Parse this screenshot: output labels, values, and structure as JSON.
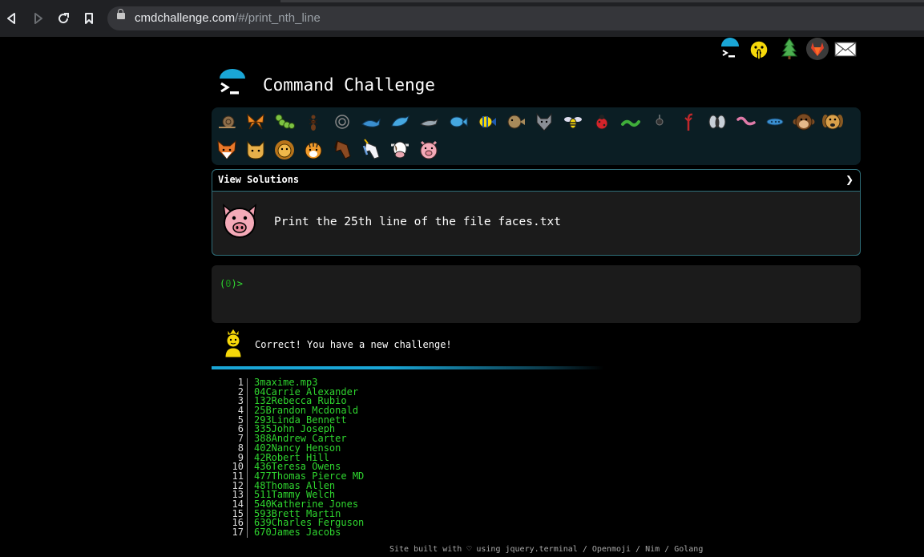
{
  "browser": {
    "url_host": "cmdchallenge.com",
    "url_path": "/#/print_nth_line"
  },
  "top_icons": [
    "terminal-icon",
    "shushing-face-icon",
    "tree-icon",
    "gitlab-icon",
    "envelope-icon"
  ],
  "header": {
    "title": "Command Challenge"
  },
  "emoji_panel": {
    "row1": [
      "snail",
      "butterfly",
      "caterpillar",
      "ant",
      "shell",
      "whale",
      "dolphin",
      "dolphin-grey",
      "fish",
      "tropical-fish",
      "blowfish",
      "wolf",
      "bee",
      "ladybug",
      "worm",
      "spider",
      "scorpion",
      "fly",
      "earthworm",
      "microbe",
      "monkey-face",
      "dog-face"
    ],
    "row2": [
      "fox-face",
      "cat-face",
      "lion-face",
      "tiger-face",
      "horse-face",
      "unicorn-face",
      "cow-face",
      "pig-face"
    ]
  },
  "challenge": {
    "view_solutions_label": "View Solutions",
    "chevron": "❯",
    "description": "Print the 25th line of the file faces.txt"
  },
  "terminal": {
    "prompt_open": "(",
    "prompt_zero": "0",
    "prompt_close": ")>"
  },
  "status": {
    "message": "Correct! You have a new challenge!"
  },
  "output": {
    "lines": [
      {
        "n": "1",
        "text": "3maxime.mp3"
      },
      {
        "n": "2",
        "text": "04Carrie Alexander"
      },
      {
        "n": "3",
        "text": "132Rebecca Rubio"
      },
      {
        "n": "4",
        "text": "25Brandon Mcdonald"
      },
      {
        "n": "5",
        "text": "293Linda Bennett"
      },
      {
        "n": "6",
        "text": "335John Joseph"
      },
      {
        "n": "7",
        "text": "388Andrew Carter"
      },
      {
        "n": "8",
        "text": "402Nancy Henson"
      },
      {
        "n": "9",
        "text": "42Robert Hill"
      },
      {
        "n": "10",
        "text": "436Teresa Owens"
      },
      {
        "n": "11",
        "text": "477Thomas Pierce MD"
      },
      {
        "n": "12",
        "text": "48Thomas Allen"
      },
      {
        "n": "13",
        "text": "511Tammy Welch"
      },
      {
        "n": "14",
        "text": "540Katherine Jones"
      },
      {
        "n": "15",
        "text": "593Brett Martin"
      },
      {
        "n": "16",
        "text": "639Charles Ferguson"
      },
      {
        "n": "17",
        "text": "670James Jacobs"
      }
    ]
  },
  "footer": {
    "text": "Site built with ♡ using jquery.terminal / Openmoji / Nim / Golang"
  },
  "colors": {
    "accent": "#1aa6d6",
    "terminal_green": "#2fd62f",
    "panel_bg": "#0b1e24"
  }
}
